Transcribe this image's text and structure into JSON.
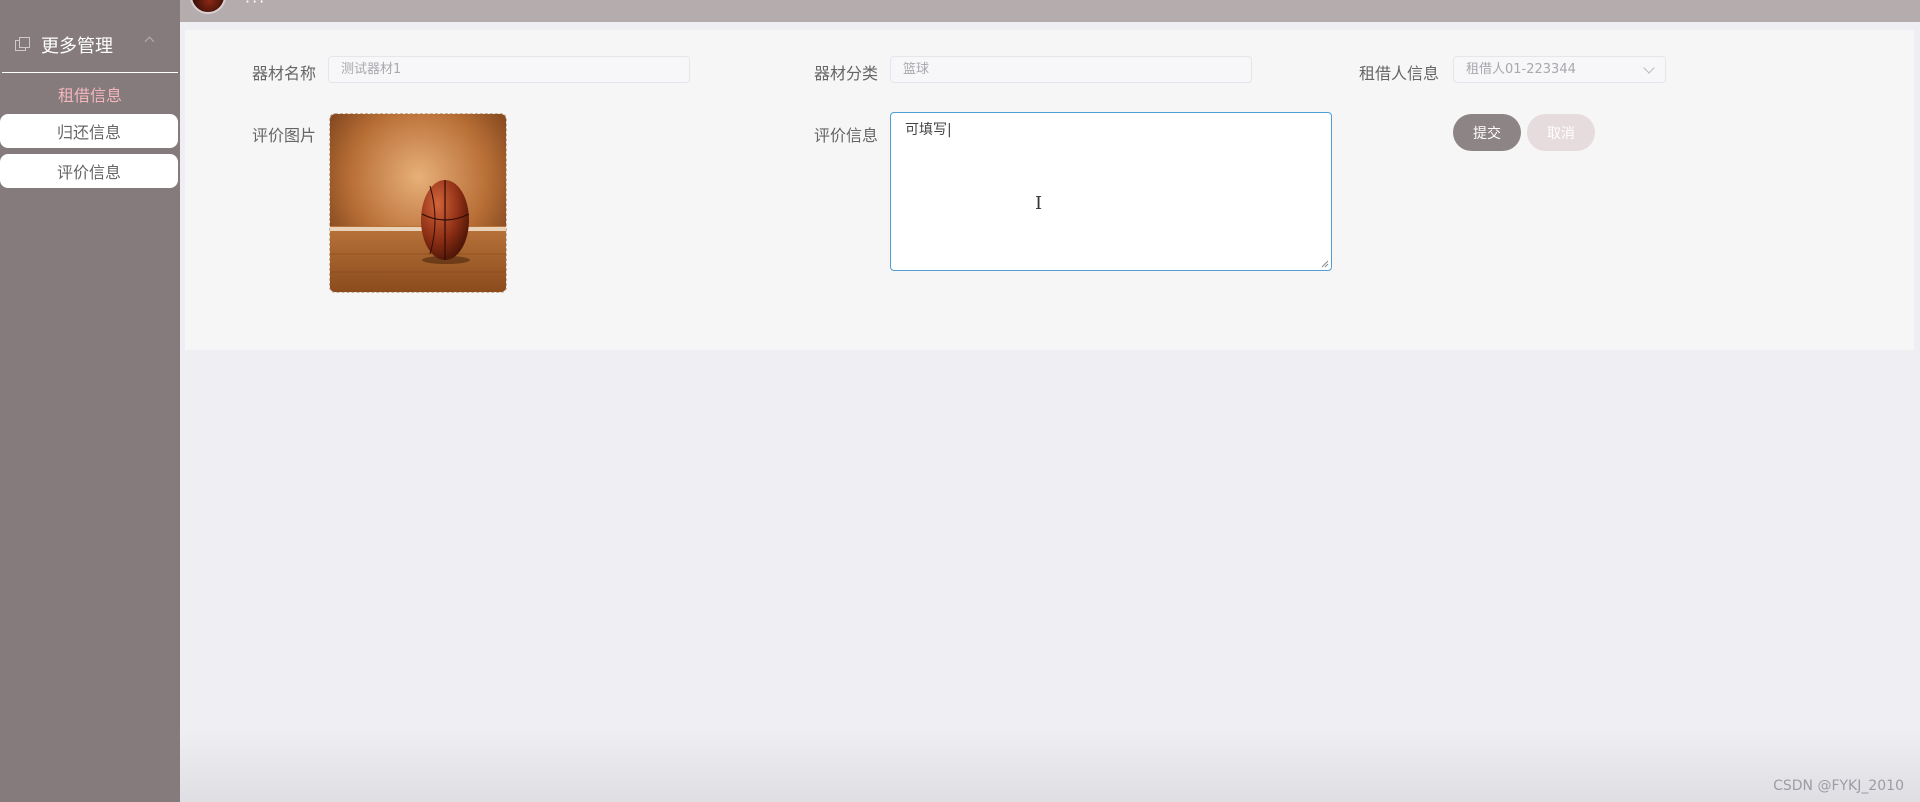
{
  "header": {
    "title": "···"
  },
  "sidebar": {
    "group_label": "更多管理",
    "items": [
      {
        "label": "租借信息",
        "active": true
      },
      {
        "label": "归还信息",
        "active": false
      },
      {
        "label": "评价信息",
        "active": false
      }
    ]
  },
  "form": {
    "equipment_name": {
      "label": "器材名称",
      "value": "测试器材1"
    },
    "equipment_category": {
      "label": "器材分类",
      "value": "篮球"
    },
    "renter_info": {
      "label": "租借人信息",
      "value": "租借人01-223344"
    },
    "review_image": {
      "label": "评价图片"
    },
    "review_info": {
      "label": "评价信息",
      "value": "可填写|"
    }
  },
  "buttons": {
    "submit_label": "提交",
    "cancel_label": "取消"
  },
  "watermark": "CSDN @FYKJ_2010",
  "colors": {
    "sidebar_bg": "#857b7c",
    "active_item": "#f2b6bb",
    "submit_bg": "#8d8485",
    "cancel_bg": "#e6dcdd",
    "focus_border": "#4f9fd6"
  }
}
